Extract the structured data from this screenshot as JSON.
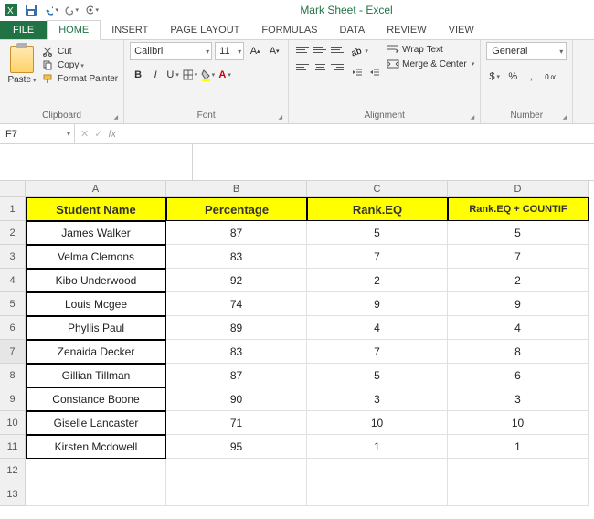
{
  "app": {
    "title": "Mark Sheet - Excel"
  },
  "tabs": {
    "file": "FILE",
    "home": "HOME",
    "insert": "INSERT",
    "page_layout": "PAGE LAYOUT",
    "formulas": "FORMULAS",
    "data": "DATA",
    "review": "REVIEW",
    "view": "VIEW"
  },
  "ribbon": {
    "clipboard": {
      "paste": "Paste",
      "cut": "Cut",
      "copy": "Copy",
      "format_painter": "Format Painter",
      "label": "Clipboard"
    },
    "font": {
      "name": "Calibri",
      "size": "11",
      "label": "Font"
    },
    "alignment": {
      "wrap_text": "Wrap Text",
      "merge_center": "Merge & Center",
      "label": "Alignment"
    },
    "number": {
      "format": "General",
      "label": "Number"
    }
  },
  "namebox": "F7",
  "fx_label": "fx",
  "columns": [
    "A",
    "B",
    "C",
    "D"
  ],
  "headers": {
    "a": "Student Name",
    "b": "Percentage",
    "c": "Rank.EQ",
    "d": "Rank.EQ + COUNTIF"
  },
  "rows": [
    {
      "n": "2",
      "name": "James Walker",
      "pct": "87",
      "rankeq": "5",
      "rankcount": "5"
    },
    {
      "n": "3",
      "name": "Velma Clemons",
      "pct": "83",
      "rankeq": "7",
      "rankcount": "7"
    },
    {
      "n": "4",
      "name": "Kibo Underwood",
      "pct": "92",
      "rankeq": "2",
      "rankcount": "2"
    },
    {
      "n": "5",
      "name": "Louis Mcgee",
      "pct": "74",
      "rankeq": "9",
      "rankcount": "9"
    },
    {
      "n": "6",
      "name": "Phyllis Paul",
      "pct": "89",
      "rankeq": "4",
      "rankcount": "4"
    },
    {
      "n": "7",
      "name": "Zenaida Decker",
      "pct": "83",
      "rankeq": "7",
      "rankcount": "8"
    },
    {
      "n": "8",
      "name": "Gillian Tillman",
      "pct": "87",
      "rankeq": "5",
      "rankcount": "6"
    },
    {
      "n": "9",
      "name": "Constance Boone",
      "pct": "90",
      "rankeq": "3",
      "rankcount": "3"
    },
    {
      "n": "10",
      "name": "Giselle Lancaster",
      "pct": "71",
      "rankeq": "10",
      "rankcount": "10"
    },
    {
      "n": "11",
      "name": "Kirsten Mcdowell",
      "pct": "95",
      "rankeq": "1",
      "rankcount": "1"
    }
  ],
  "empty_rows": [
    "12",
    "13"
  ],
  "symbols": {
    "currency": "$",
    "percent": "%",
    "comma": ","
  }
}
